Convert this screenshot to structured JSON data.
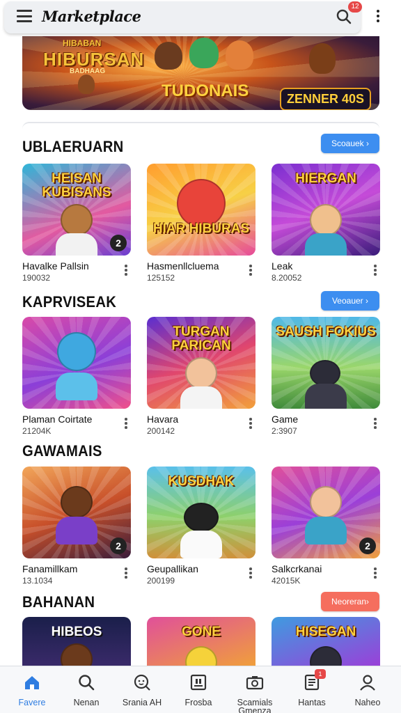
{
  "app": {
    "title": "Marketplace",
    "notification_count": "12"
  },
  "hero": {
    "top_text": "HIBABAN",
    "title": "HIBURSAN",
    "subtitle": "BADHAAG",
    "center_text": "TUDONAIS",
    "right_text": "ZENNER 40S"
  },
  "sections": [
    {
      "title": "UBLAERUARN",
      "button": "Scoauek ›",
      "cards": [
        {
          "art": "HEISAN KUBISANS",
          "name": "Havalke Pallsin",
          "count": "190032",
          "badge": "2"
        },
        {
          "art": "HIAR HIBURAS",
          "name": "Hasmenllcluema",
          "count": "125152",
          "badge": ""
        },
        {
          "art": "HIERGAN",
          "name": "Leak",
          "count": "8.20052",
          "badge": ""
        }
      ]
    },
    {
      "title": "KAPRVISEAK",
      "button": "Veoauer ›",
      "cards": [
        {
          "art": "",
          "name": "Plaman Coirtate",
          "count": "21204K",
          "badge": ""
        },
        {
          "art": "TURGAN PARICAN",
          "name": "Havara",
          "count": "200142",
          "badge": ""
        },
        {
          "art": "SAUSH FOKIUS",
          "name": "Game",
          "count": "2:3907",
          "badge": ""
        }
      ]
    },
    {
      "title": "GAWAMAIS",
      "button": "",
      "cards": [
        {
          "art": "",
          "name": "Fanamillkam",
          "count": "13.1034",
          "badge": "2"
        },
        {
          "art": "KUSDHAK",
          "name": "Geupallikan",
          "count": "200199",
          "badge": ""
        },
        {
          "art": "",
          "name": "Salkcrkanai",
          "count": "42015K",
          "badge": "2"
        }
      ]
    },
    {
      "title": "BAHANAN",
      "button": "Neoreran›",
      "cards": [
        {
          "art": "HIBEOS",
          "name": "",
          "count": "",
          "badge": ""
        },
        {
          "art": "GONE",
          "name": "",
          "count": "",
          "badge": ""
        },
        {
          "art": "HISEGAN",
          "name": "",
          "count": "",
          "badge": ""
        }
      ]
    }
  ],
  "nav": {
    "items": [
      {
        "label": "Favere",
        "icon": "home-icon"
      },
      {
        "label": "Nenan",
        "icon": "search-icon"
      },
      {
        "label": "Srania AH",
        "icon": "face-search-icon"
      },
      {
        "label": "Frosba",
        "icon": "grid-box-icon"
      },
      {
        "label": "Scamials Gmenza",
        "icon": "camera-icon"
      },
      {
        "label": "Hantas",
        "icon": "document-icon"
      },
      {
        "label": "Naheo",
        "icon": "user-icon"
      }
    ],
    "badge": "1"
  },
  "colors": {
    "accent": "#3d8ef0",
    "accent_alt": "#f56e5e",
    "active_nav": "#2f7de1",
    "badge": "#e64848"
  }
}
